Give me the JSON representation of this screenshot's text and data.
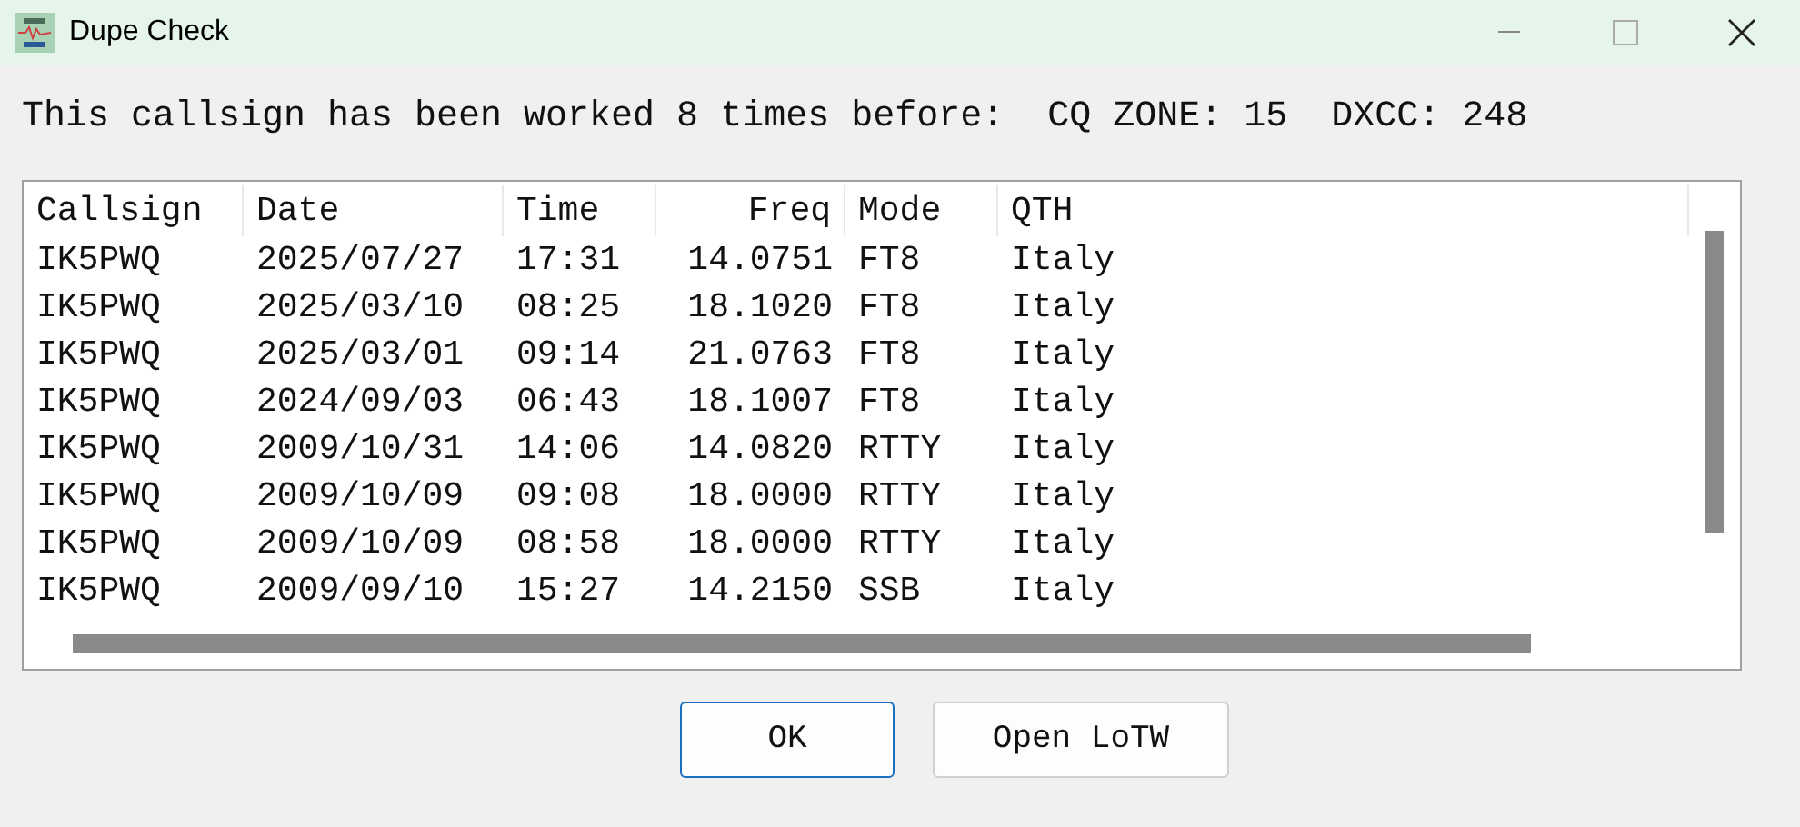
{
  "window": {
    "title": "Dupe Check"
  },
  "message": {
    "text": "This callsign has been worked 8 times before:",
    "cq_zone": "CQ ZONE: 15",
    "dxcc": "DXCC: 248"
  },
  "table": {
    "columns": [
      "Callsign",
      "Date",
      "Time",
      "Freq",
      "Mode",
      "QTH"
    ],
    "rows": [
      [
        "IK5PWQ",
        "2025/07/27",
        "17:31",
        "14.0751",
        "FT8",
        "Italy"
      ],
      [
        "IK5PWQ",
        "2025/03/10",
        "08:25",
        "18.1020",
        "FT8",
        "Italy"
      ],
      [
        "IK5PWQ",
        "2025/03/01",
        "09:14",
        "21.0763",
        "FT8",
        "Italy"
      ],
      [
        "IK5PWQ",
        "2024/09/03",
        "06:43",
        "18.1007",
        "FT8",
        "Italy"
      ],
      [
        "IK5PWQ",
        "2009/10/31",
        "14:06",
        "14.0820",
        "RTTY",
        "Italy"
      ],
      [
        "IK5PWQ",
        "2009/10/09",
        "09:08",
        "18.0000",
        "RTTY",
        "Italy"
      ],
      [
        "IK5PWQ",
        "2009/10/09",
        "08:58",
        "18.0000",
        "RTTY",
        "Italy"
      ],
      [
        "IK5PWQ",
        "2009/09/10",
        "15:27",
        "14.2150",
        "SSB",
        "Italy"
      ]
    ]
  },
  "buttons": [
    {
      "label": "OK",
      "selected": true
    },
    {
      "label": "Open LoTW",
      "selected": false
    }
  ]
}
